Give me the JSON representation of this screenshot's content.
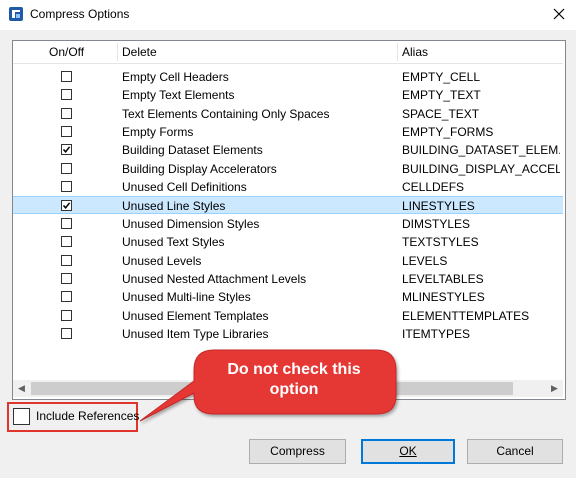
{
  "window": {
    "title": "Compress Options",
    "close": "✕"
  },
  "table": {
    "columns": {
      "onoff": "On/Off",
      "delete": "Delete",
      "alias": "Alias"
    },
    "rows": [
      {
        "checked": false,
        "delete": "Empty Cell Headers",
        "alias": "EMPTY_CELL"
      },
      {
        "checked": false,
        "delete": "Empty Text Elements",
        "alias": "EMPTY_TEXT"
      },
      {
        "checked": false,
        "delete": "Text Elements Containing Only Spaces",
        "alias": "SPACE_TEXT"
      },
      {
        "checked": false,
        "delete": "Empty Forms",
        "alias": "EMPTY_FORMS"
      },
      {
        "checked": true,
        "delete": "Building Dataset Elements",
        "alias": "BUILDING_DATASET_ELEM..."
      },
      {
        "checked": false,
        "delete": "Building Display Accelerators",
        "alias": "BUILDING_DISPLAY_ACCEL..."
      },
      {
        "checked": false,
        "delete": "Unused Cell Definitions",
        "alias": "CELLDEFS"
      },
      {
        "checked": true,
        "delete": "Unused Line Styles",
        "alias": "LINESTYLES",
        "selected": true
      },
      {
        "checked": false,
        "delete": "Unused Dimension Styles",
        "alias": "DIMSTYLES"
      },
      {
        "checked": false,
        "delete": "Unused Text Styles",
        "alias": "TEXTSTYLES"
      },
      {
        "checked": false,
        "delete": "Unused Levels",
        "alias": "LEVELS"
      },
      {
        "checked": false,
        "delete": "Unused Nested Attachment Levels",
        "alias": "LEVELTABLES"
      },
      {
        "checked": false,
        "delete": "Unused Multi-line Styles",
        "alias": "MLINESTYLES"
      },
      {
        "checked": false,
        "delete": "Unused Element Templates",
        "alias": "ELEMENTTEMPLATES"
      },
      {
        "checked": false,
        "delete": "Unused Item Type Libraries",
        "alias": "ITEMTYPES"
      }
    ]
  },
  "include_references": {
    "label": "Include References",
    "checked": false
  },
  "callout": {
    "line1": "Do not check this",
    "line2": "option",
    "color": "#e53935"
  },
  "buttons": {
    "compress": "Compress",
    "ok": "OK",
    "cancel": "Cancel"
  },
  "colors": {
    "selection": "#cce8ff",
    "highlight_border": "#e0352c",
    "default_button": "#0078d7"
  }
}
